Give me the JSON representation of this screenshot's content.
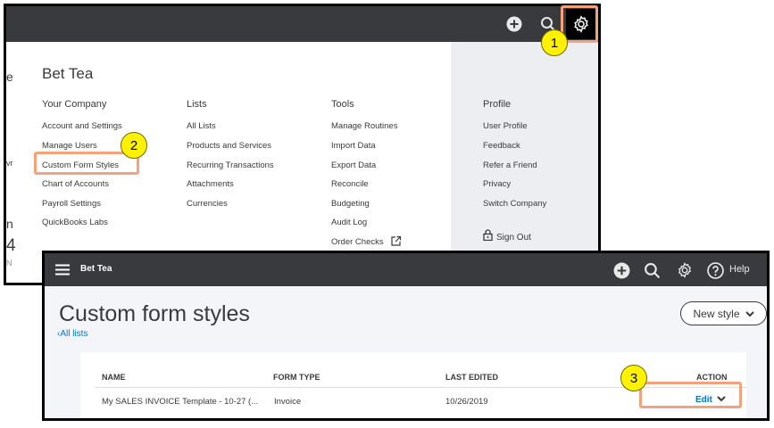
{
  "gear_menu": {
    "company": "Bet Tea",
    "left_edge_fragments": [
      "e",
      "vr",
      "n",
      "4",
      "N"
    ],
    "columns": [
      {
        "heading": "Your Company",
        "items": [
          "Account and Settings",
          "Manage Users",
          "Custom Form Styles",
          "Chart of Accounts",
          "Payroll Settings",
          "QuickBooks Labs"
        ]
      },
      {
        "heading": "Lists",
        "items": [
          "All Lists",
          "Products and Services",
          "Recurring Transactions",
          "Attachments",
          "Currencies"
        ]
      },
      {
        "heading": "Tools",
        "items": [
          "Manage Routines",
          "Import Data",
          "Export Data",
          "Reconcile",
          "Budgeting",
          "Audit Log",
          "Order Checks"
        ]
      },
      {
        "heading": "Profile",
        "items": [
          "User Profile",
          "Feedback",
          "Refer a Friend",
          "Privacy",
          "Switch Company"
        ]
      }
    ],
    "sign_out": "Sign Out"
  },
  "callouts": [
    "1",
    "2",
    "3"
  ],
  "custom_form_styles": {
    "app_title": "Bet Tea",
    "help": "Help",
    "page_title": "Custom form styles",
    "back_link": "All lists",
    "new_style": "New style",
    "table": {
      "headers": [
        "NAME",
        "FORM TYPE",
        "LAST EDITED",
        "ACTION"
      ],
      "rows": [
        {
          "name": "My SALES INVOICE Template - 10-27 (...",
          "form_type": "Invoice",
          "last_edited": "10/26/2019",
          "action": "Edit"
        }
      ]
    }
  },
  "icons": [
    "plus-icon",
    "search-icon",
    "gear-icon",
    "help-icon",
    "hamburger-icon",
    "external-link-icon",
    "lock-icon",
    "chevron-down-icon",
    "chevron-left-icon"
  ],
  "colors": {
    "topbar": "#393a3d",
    "link": "#0077c5",
    "highlight": "#f3a27c",
    "callout": "#fff200",
    "profile_bg": "#eceef1"
  }
}
